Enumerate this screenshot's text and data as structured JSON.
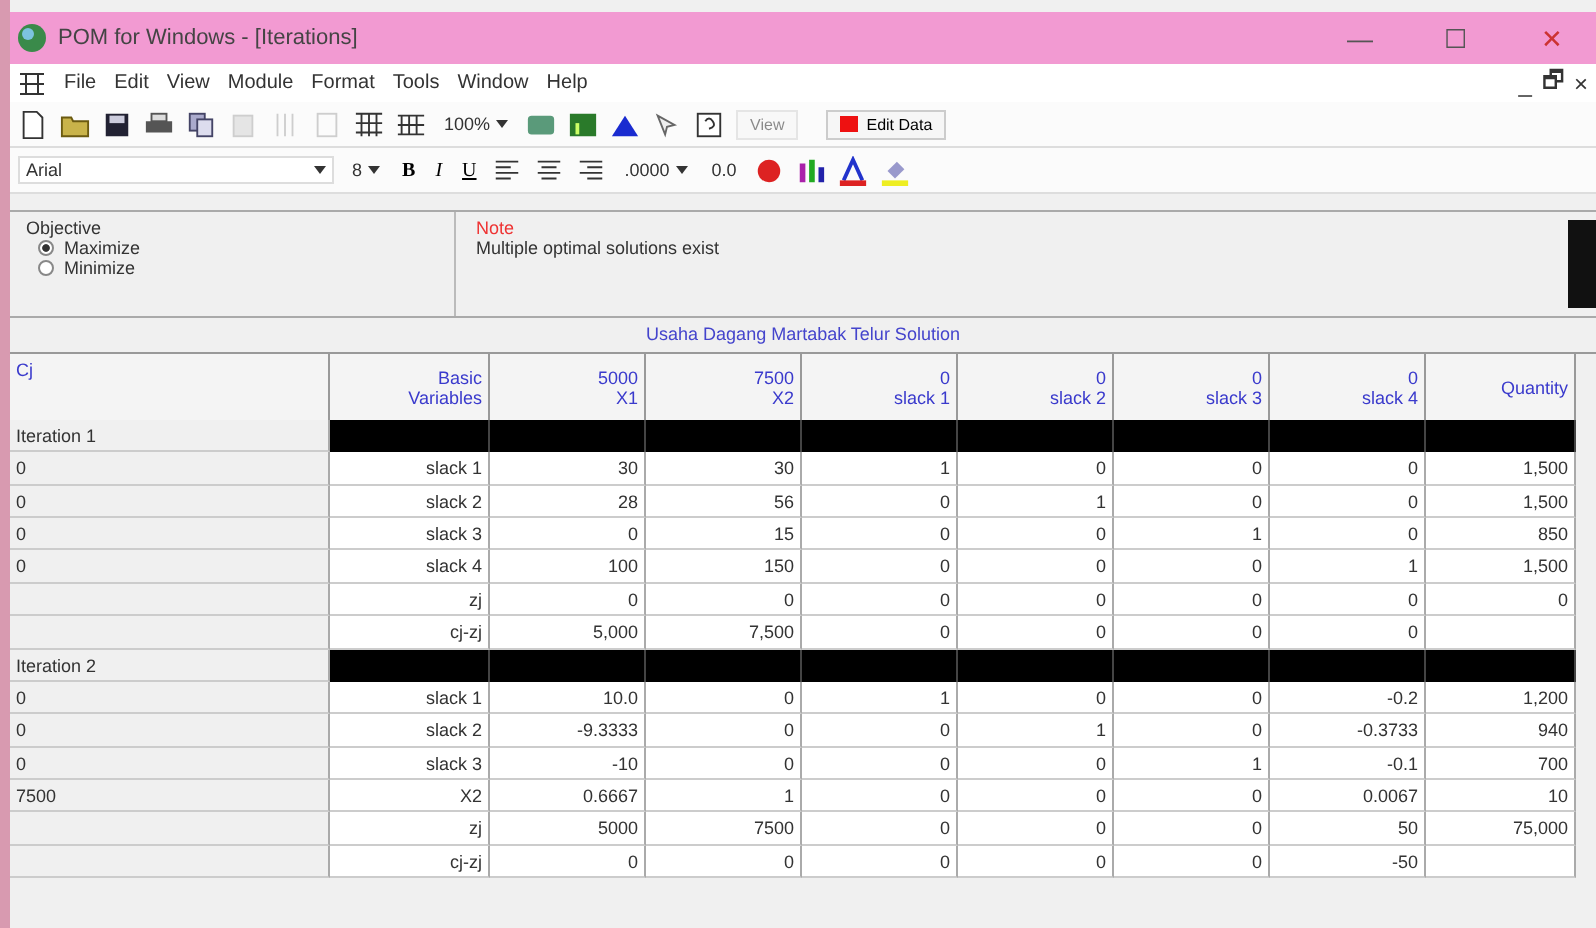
{
  "window": {
    "title": "POM for Windows - [Iterations]",
    "controls": [
      "—",
      "☐",
      "✕"
    ],
    "child_controls": [
      "_",
      "🗗",
      "×"
    ]
  },
  "menu": [
    "File",
    "Edit",
    "View",
    "Module",
    "Format",
    "Tools",
    "Window",
    "Help"
  ],
  "toolbar": {
    "zoom": "100%",
    "view_button": "View",
    "edit_data_button": "Edit Data"
  },
  "format_bar": {
    "font": "Arial",
    "size": "8",
    "bold": "B",
    "italic": "I",
    "underline": "U",
    "decimals": ".0000",
    "fixed": "0.0"
  },
  "objective": {
    "title": "Objective",
    "options": [
      {
        "label": "Maximize",
        "selected": true
      },
      {
        "label": "Minimize",
        "selected": false
      }
    ]
  },
  "note": {
    "label": "Note",
    "text": "Multiple optimal solutions exist"
  },
  "table": {
    "caption": "Usaha Dagang Martabak Telur Solution",
    "columns": [
      [
        "Cj"
      ],
      [
        "Basic",
        "Variables"
      ],
      [
        "5000",
        "X1"
      ],
      [
        "7500",
        "X2"
      ],
      [
        "0",
        "slack 1"
      ],
      [
        "0",
        "slack 2"
      ],
      [
        "0",
        "slack 3"
      ],
      [
        "0",
        "slack 4"
      ],
      [
        "Quantity"
      ]
    ],
    "iterations": [
      {
        "label": "Iteration 1",
        "rows": [
          {
            "cj": "0",
            "cells": [
              "slack 1",
              "30",
              "30",
              "1",
              "0",
              "0",
              "0",
              "1,500"
            ]
          },
          {
            "cj": "0",
            "cells": [
              "slack 2",
              "28",
              "56",
              "0",
              "1",
              "0",
              "0",
              "1,500"
            ]
          },
          {
            "cj": "0",
            "cells": [
              "slack 3",
              "0",
              "15",
              "0",
              "0",
              "1",
              "0",
              "850"
            ]
          },
          {
            "cj": "0",
            "cells": [
              "slack 4",
              "100",
              "150",
              "0",
              "0",
              "0",
              "1",
              "1,500"
            ]
          },
          {
            "cells": [
              "zj",
              "0",
              "0",
              "0",
              "0",
              "0",
              "0",
              "0"
            ]
          },
          {
            "cells": [
              "cj-zj",
              "5,000",
              "7,500",
              "0",
              "0",
              "0",
              "0"
            ]
          }
        ]
      },
      {
        "label": "Iteration 2",
        "rows": [
          {
            "cj": "0",
            "cells": [
              "slack 1",
              "10.0",
              "0",
              "1",
              "0",
              "0",
              "-0.2",
              "1,200"
            ]
          },
          {
            "cj": "0",
            "cells": [
              "slack 2",
              "-9.3333",
              "0",
              "0",
              "1",
              "0",
              "-0.3733",
              "940"
            ]
          },
          {
            "cj": "0",
            "cells": [
              "slack 3",
              "-10",
              "0",
              "0",
              "0",
              "1",
              "-0.1",
              "700"
            ]
          },
          {
            "cj": "7500",
            "cells": [
              "X2",
              "0.6667",
              "1",
              "0",
              "0",
              "0",
              "0.0067",
              "10"
            ]
          },
          {
            "cells": [
              "zj",
              "5000",
              "7500",
              "0",
              "0",
              "0",
              "50",
              "75,000"
            ]
          },
          {
            "cells": [
              "cj-zj",
              "0",
              "0",
              "0",
              "0",
              "0",
              "-50"
            ]
          }
        ]
      }
    ]
  }
}
